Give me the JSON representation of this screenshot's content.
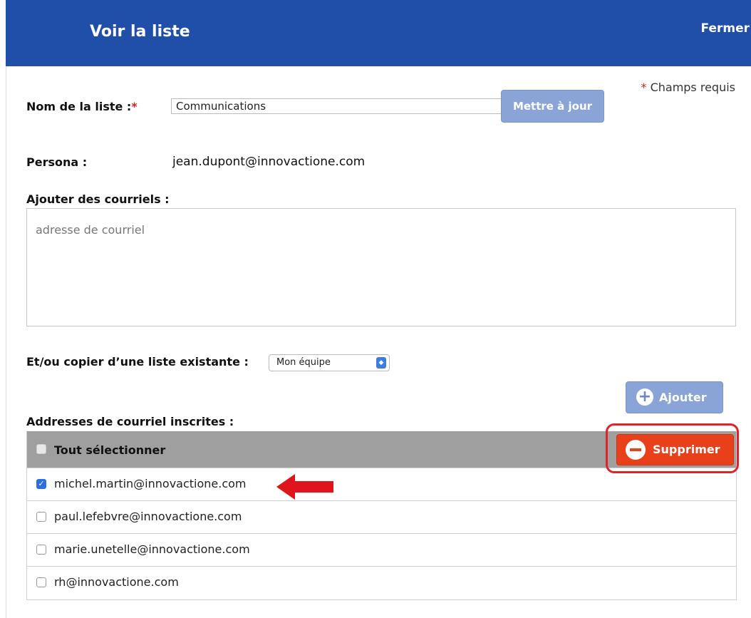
{
  "header": {
    "title": "Voir la liste",
    "close_label": "Fermer"
  },
  "required_note": {
    "star": "*",
    "text": " Champs requis"
  },
  "list_name": {
    "label": "Nom de la liste :",
    "star": "*",
    "value": "Communications",
    "update_label": "Mettre à jour"
  },
  "persona": {
    "label": "Persona :",
    "value": "jean.dupont@innovactione.com"
  },
  "add_emails": {
    "label": "Ajouter des courriels :",
    "placeholder": "adresse de courriel"
  },
  "copy_list": {
    "label": "Et/ou copier d’une liste existante :",
    "selected": "Mon équipe"
  },
  "add_button": {
    "label": "Ajouter"
  },
  "subscribed": {
    "label": "Addresses de courriel inscrites :",
    "select_all": "Tout sélectionner",
    "delete_label": "Supprimer",
    "rows": [
      {
        "email": "michel.martin@innovactione.com",
        "checked": true
      },
      {
        "email": "paul.lefebvre@innovactione.com",
        "checked": false
      },
      {
        "email": "marie.unetelle@innovactione.com",
        "checked": false
      },
      {
        "email": "rh@innovactione.com",
        "checked": false
      }
    ]
  },
  "colors": {
    "header": "#1f4fa8",
    "primary_button": "#8aa4d8",
    "delete_button": "#e8401a",
    "highlight": "#e0222a"
  }
}
